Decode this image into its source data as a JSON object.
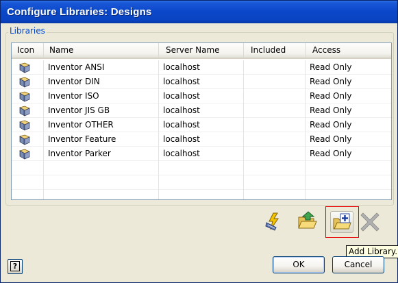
{
  "window": {
    "title": "Configure Libraries: Designs"
  },
  "libraries": {
    "legend": "Libraries",
    "columns": [
      "Icon",
      "Name",
      "Server Name",
      "Included",
      "Access"
    ],
    "rows": [
      {
        "icon": "library-icon",
        "name": "Inventor ANSI",
        "server": "localhost",
        "included": "",
        "access": "Read Only"
      },
      {
        "icon": "library-icon",
        "name": "Inventor DIN",
        "server": "localhost",
        "included": "",
        "access": "Read Only"
      },
      {
        "icon": "library-icon",
        "name": "Inventor ISO",
        "server": "localhost",
        "included": "",
        "access": "Read Only"
      },
      {
        "icon": "library-icon",
        "name": "Inventor JIS GB",
        "server": "localhost",
        "included": "",
        "access": "Read Only"
      },
      {
        "icon": "library-icon",
        "name": "Inventor OTHER",
        "server": "localhost",
        "included": "",
        "access": "Read Only"
      },
      {
        "icon": "library-icon",
        "name": "Inventor Feature",
        "server": "localhost",
        "included": "",
        "access": "Read Only"
      },
      {
        "icon": "library-icon",
        "name": "Inventor Parker",
        "server": "localhost",
        "included": "",
        "access": "Read Only"
      }
    ]
  },
  "toolbar": {
    "icons": [
      "lightning-wizard-icon",
      "open-folder-icon",
      "add-library-icon",
      "delete-x-icon"
    ],
    "tooltip": "Add Library."
  },
  "buttons": {
    "ok": "OK",
    "cancel": "Cancel",
    "help": "?"
  },
  "colors": {
    "titlebar": "#0a47c8",
    "highlight": "#e60000",
    "legend": "#0046d5"
  }
}
